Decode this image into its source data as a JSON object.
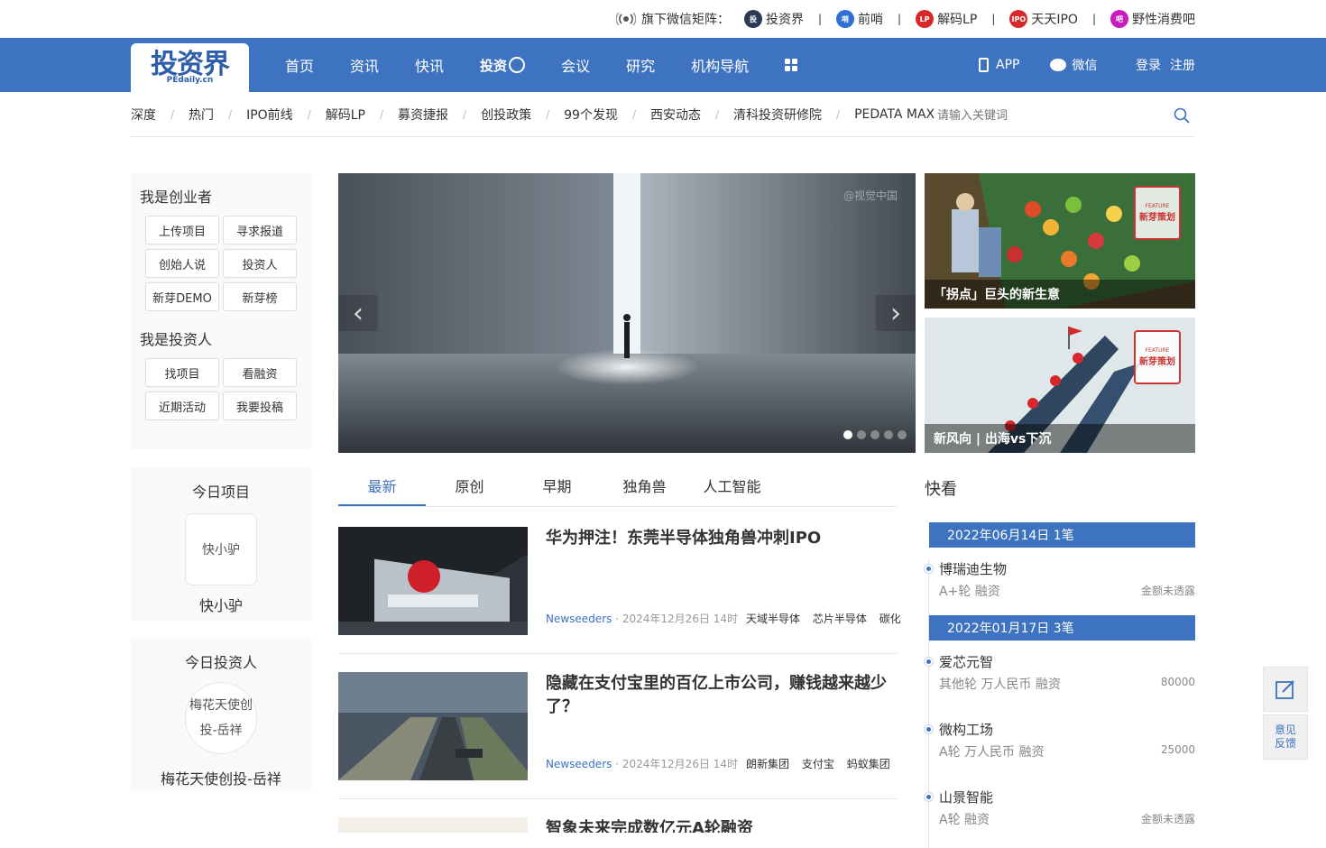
{
  "topbar": {
    "matrix_label": "旗下微信矩阵：",
    "accounts": [
      {
        "label": "投资界",
        "color": "#2b3a55",
        "icon": "pedaily-icon"
      },
      {
        "label": "前哨",
        "color": "#2f6fd1",
        "icon": "qianshao-icon"
      },
      {
        "label": "解码LP",
        "color": "#d8272b",
        "icon": "jiemalp-icon"
      },
      {
        "label": "天天IPO",
        "color": "#d8272b",
        "icon": "ipo-icon"
      },
      {
        "label": "野性消费吧",
        "color": "#c61cc0",
        "icon": "consume-icon"
      }
    ],
    "separator": "|"
  },
  "logo": {
    "main": "投资界",
    "sub": "PEdaily.cn"
  },
  "nav": {
    "items": [
      "首页",
      "资讯",
      "快讯"
    ],
    "special": "投资",
    "items2": [
      "会议",
      "研究",
      "机构导航"
    ],
    "app": "APP",
    "wechat": "微信",
    "login": "登录",
    "register": "注册"
  },
  "subnav": {
    "items": [
      "深度",
      "热门",
      "IPO前线",
      "解码LP",
      "募资捷报",
      "创投政策",
      "99个发现",
      "西安动态",
      "清科投资研修院",
      "PEDATA MAX"
    ],
    "separator": "/",
    "search_placeholder": "请输入关键词"
  },
  "left": {
    "founder_title": "我是创业者",
    "founder_buttons": [
      "上传项目",
      "寻求报道",
      "创始人说",
      "投资人",
      "新芽DEMO",
      "新芽榜"
    ],
    "investor_title": "我是投资人",
    "investor_buttons": [
      "找项目",
      "看融资",
      "近期活动",
      "我要投稿"
    ],
    "today_project_title": "今日项目",
    "today_project_img_alt": "快小驴",
    "today_project_name": "快小驴",
    "today_investor_title": "今日投资人",
    "today_investor_img_alt": "梅花天使创投-岳祥",
    "today_investor_name": "梅花天使创投-岳祥"
  },
  "carousel": {
    "watermark": "@视觉中国",
    "prev": "‹",
    "next": "›",
    "total_slides": 5,
    "active_slide": 1
  },
  "features": [
    {
      "caption": "「拐点」巨头的新生意",
      "stamp_top": "FEATURE",
      "stamp_main": "新芽策划"
    },
    {
      "caption": "新风向 | 出海vs下沉",
      "stamp_top": "FEATURE",
      "stamp_main": "新芽策划"
    }
  ],
  "tabs": [
    "最新",
    "原创",
    "早期",
    "独角兽",
    "人工智能"
  ],
  "articles": [
    {
      "title": "华为押注！东莞半导体独角兽冲刺IPO",
      "source": "Newseeders",
      "dot": "·",
      "time": "2024年12月26日 14时",
      "tags": [
        "天域半导体",
        "芯片半导体",
        "碳化"
      ]
    },
    {
      "title": "隐藏在支付宝里的百亿上市公司，赚钱越来越少了？",
      "source": "Newseeders",
      "dot": "·",
      "time": "2024年12月26日 14时",
      "tags": [
        "朗新集团",
        "支付宝",
        "蚂蚁集团"
      ]
    },
    {
      "title": "智象未来完成数亿元A轮融资"
    }
  ],
  "quick": {
    "title": "快看",
    "groups": [
      {
        "date": "2022年06月14日 1笔",
        "items": [
          {
            "name": "博瑞迪生物",
            "round": "A+轮 融资",
            "amount": "金额未透露"
          }
        ]
      },
      {
        "date": "2022年01月17日 3笔",
        "items": [
          {
            "name": "爱芯元智",
            "round": "其他轮 万人民币 融资",
            "amount": "80000"
          },
          {
            "name": "微构工场",
            "round": "A轮 万人民币 融资",
            "amount": "25000"
          },
          {
            "name": "山景智能",
            "round": "A轮 融资",
            "amount": "金额未透露"
          }
        ]
      }
    ]
  },
  "feedback": {
    "label": "意见反馈"
  },
  "colors": {
    "brand": "#3d73c0",
    "accent_red": "#c33"
  }
}
